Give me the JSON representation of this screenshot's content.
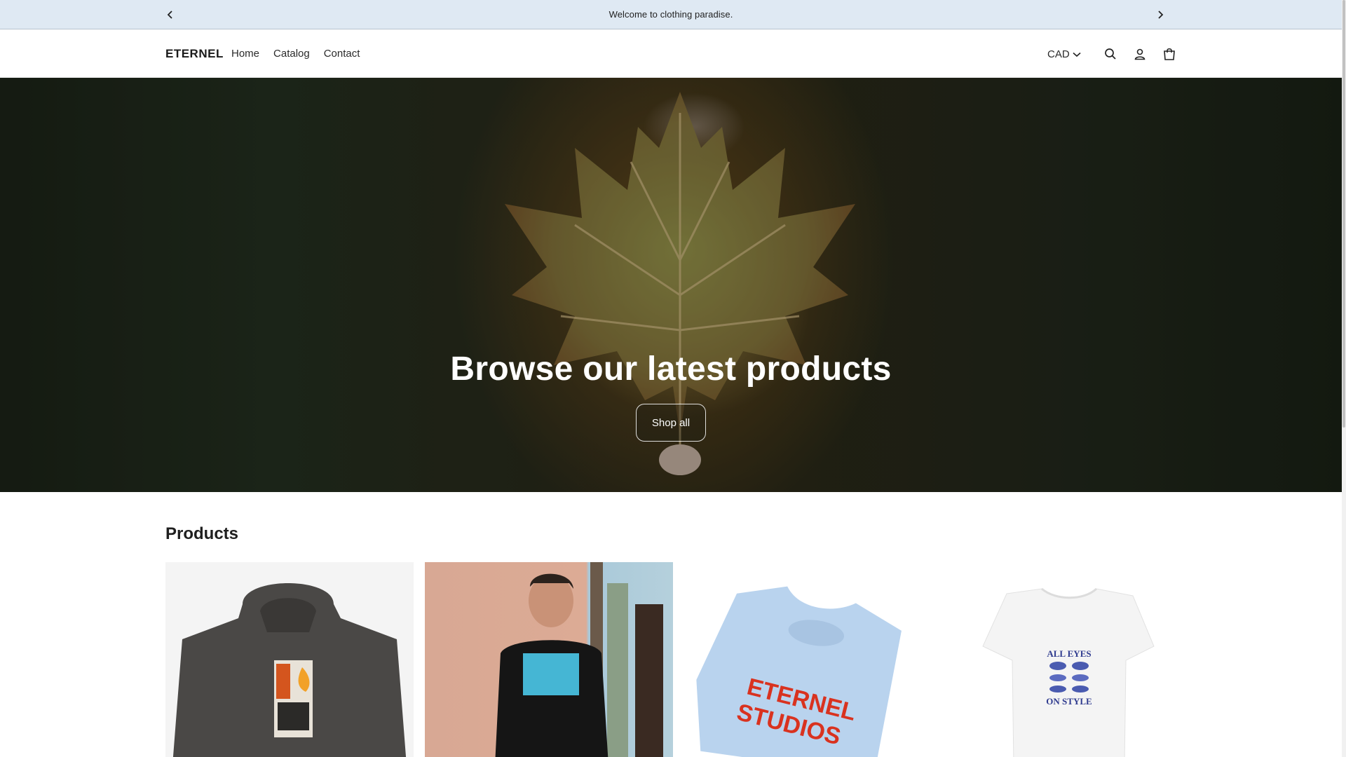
{
  "announcement": {
    "message": "Welcome to clothing paradise.",
    "prev_icon": "chevron-left-icon",
    "next_icon": "chevron-right-icon"
  },
  "header": {
    "logo": "ETERNEL",
    "nav": [
      {
        "label": "Home"
      },
      {
        "label": "Catalog"
      },
      {
        "label": "Contact"
      }
    ],
    "currency": "CAD",
    "icons": [
      "search-icon",
      "account-icon",
      "cart-icon"
    ]
  },
  "hero": {
    "title": "Browse our latest products",
    "button_label": "Shop all"
  },
  "products": {
    "title": "Products",
    "items": [
      {
        "image": "washed-black-hoodie-flame-graphic"
      },
      {
        "image": "man-in-black-hoodie-blue-print"
      },
      {
        "image": "light-blue-tee-eternel-studios"
      },
      {
        "image": "white-tee-all-eyes-on-style"
      }
    ],
    "printed_graphics": {
      "tee_3": [
        "ETERNEL",
        "STUDIOS"
      ],
      "tee_4": [
        "ALL EYES",
        "ON STYLE"
      ]
    }
  },
  "colors": {
    "announcement_bg": "#dfe9f3",
    "text": "#1a1a1a",
    "hero_text": "#ffffff"
  }
}
